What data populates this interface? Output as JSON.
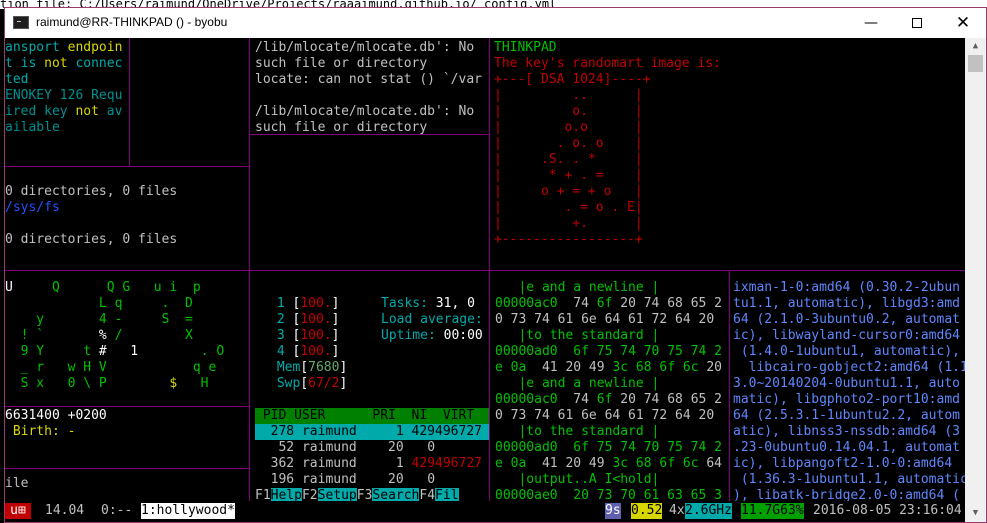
{
  "background": {
    "strip_text": "tion file: C:/Users/raimund/OneDrive/Projects/raaaimund.github.io/_config.yml"
  },
  "window": {
    "title": "raimund@RR-THINKPAD () - byobu",
    "icon": "console-icon",
    "minimize": "—",
    "close": "✕"
  },
  "pane_tl": {
    "lines": [
      {
        "segs": [
          {
            "t": "ansport ",
            "c": "c"
          },
          {
            "t": "endpoin",
            "c": "y"
          }
        ]
      },
      {
        "segs": [
          {
            "t": "t is ",
            "c": "c"
          },
          {
            "t": "not",
            "c": "y"
          },
          {
            "t": " connec",
            "c": "c"
          }
        ]
      },
      {
        "segs": [
          {
            "t": "ted",
            "c": "c"
          }
        ]
      },
      {
        "segs": [
          {
            "t": "ENOKEY 126 Requ",
            "c": "dg"
          }
        ]
      },
      {
        "segs": [
          {
            "t": "ired key ",
            "c": "dg"
          },
          {
            "t": "not",
            "c": "y"
          },
          {
            "t": " av",
            "c": "dg"
          }
        ]
      },
      {
        "segs": [
          {
            "t": "ailable",
            "c": "dg"
          }
        ]
      }
    ]
  },
  "pane_tm": {
    "lines": [
      "/lib/mlocate/mlocate.db': No",
      "such file or directory",
      "locate: can not stat () `/var",
      "",
      "/lib/mlocate/mlocate.db': No",
      "such file or directory"
    ]
  },
  "pane_ml": {
    "lines": [
      {
        "t": "0 directories, 0 files",
        "c": "w"
      },
      {
        "t": "/sys/fs",
        "c": "bl"
      },
      {
        "t": "",
        "c": "w"
      },
      {
        "t": "0 directories, 0 files",
        "c": "w"
      }
    ]
  },
  "randomart": {
    "host": "THINKPAD",
    "header": "The key's randomart image is:",
    "lines": [
      "+---[ DSA 1024]----+",
      "|         ..      |",
      "|         o.      |",
      "|        o.o      |",
      "|       . o. o    |",
      "|     .S. . *     |",
      "|      * + . =    |",
      "|     o + = + o   |",
      "|        . = o . E|",
      "|         +.      |",
      "+-----------------+"
    ]
  },
  "matrix": {
    "lines": [
      [
        {
          "t": "U",
          "c": "b"
        },
        {
          "t": "     Q      Q G   u i  p",
          "c": "g"
        }
      ],
      [
        {
          "t": "            L q     .  D",
          "c": "g"
        }
      ],
      [
        {
          "t": "    y       4 -     S  =",
          "c": "g"
        }
      ],
      [
        {
          "t": "  ! `       ",
          "c": "g"
        },
        {
          "t": "%",
          "c": "b"
        },
        {
          "t": " /        X",
          "c": "g"
        }
      ],
      [
        {
          "t": "  9 Y     t ",
          "c": "g"
        },
        {
          "t": "#",
          "c": "b"
        },
        {
          "t": "   ",
          "c": "g"
        },
        {
          "t": "1",
          "c": "b"
        },
        {
          "t": "        . O",
          "c": "g"
        }
      ],
      [
        {
          "t": "  _ r   w H V           q e",
          "c": "g"
        }
      ],
      [
        {
          "t": "  S x   0 \\ P        ",
          "c": "g"
        },
        {
          "t": "$",
          "c": "y"
        },
        {
          "t": "   H",
          "c": "g"
        }
      ]
    ]
  },
  "stat": {
    "lines": [
      [
        {
          "t": "6631400 +0200",
          "c": "b"
        }
      ],
      [
        {
          "t": " Birth: -",
          "c": "y"
        }
      ]
    ]
  },
  "bottom_left": {
    "text": "ile"
  },
  "htop": {
    "cpus": [
      {
        "n": "1",
        "v": "100."
      },
      {
        "n": "2",
        "v": "100."
      },
      {
        "n": "3",
        "v": "100."
      },
      {
        "n": "4",
        "v": "100."
      }
    ],
    "mem_label": "Mem",
    "mem_val": "7680",
    "swp_label": "Swp",
    "swp_val": "67/2",
    "tasks_label": "Tasks:",
    "tasks_val": "31, 0",
    "load_label": "Load average:",
    "uptime_label": "Uptime:",
    "uptime_val": "00:00",
    "headers": {
      "pid": "PID",
      "user": "USER",
      "pri": "PRI",
      "ni": "NI",
      "virt": "VIRT"
    },
    "rows": [
      {
        "pid": "278",
        "user": "raimund",
        "pri": "1",
        "ni": "429496727",
        "selected": true
      },
      {
        "pid": "52",
        "user": "raimund",
        "pri": "20",
        "ni": "0",
        "selected": false
      },
      {
        "pid": "362",
        "user": "raimund",
        "pri": "1",
        "ni": "429496727",
        "selected": false
      },
      {
        "pid": "196",
        "user": "raimund",
        "pri": "20",
        "ni": "0",
        "selected": false
      }
    ],
    "fkeys": [
      {
        "k": "F1",
        "l": "Help"
      },
      {
        "k": "F2",
        "l": "Setup"
      },
      {
        "k": "F3",
        "l": "Search"
      },
      {
        "k": "F4",
        "l": "Fil"
      }
    ]
  },
  "hexdump": {
    "lines": [
      [
        {
          "t": "   |e and a newline |",
          "c": "g"
        }
      ],
      [
        {
          "t": "00000ac0  ",
          "c": "g"
        },
        {
          "t": "74 ",
          "c": "w"
        },
        {
          "t": "6f ",
          "c": "g"
        },
        {
          "t": "20 74 68 65 2",
          "c": "w"
        }
      ],
      [
        {
          "t": "0 73 74 61 6e 64 61 72 64 20",
          "c": "w"
        }
      ],
      [
        {
          "t": "   |to the standard |",
          "c": "g"
        }
      ],
      [
        {
          "t": "00000ad0  ",
          "c": "g"
        },
        {
          "t": "6f 75 74 70 75 74 2",
          "c": "g"
        }
      ],
      [
        {
          "t": "e 0a  ",
          "c": "g"
        },
        {
          "t": "41 20 49 ",
          "c": "w"
        },
        {
          "t": "3c 68 6f 6c ",
          "c": "g"
        },
        {
          "t": "20",
          "c": "w"
        }
      ],
      [
        {
          "t": "   |e and a newline |",
          "c": "g"
        }
      ],
      [
        {
          "t": "00000ac0  ",
          "c": "g"
        },
        {
          "t": "74 ",
          "c": "w"
        },
        {
          "t": "6f ",
          "c": "g"
        },
        {
          "t": "20 74 68 65 2",
          "c": "w"
        }
      ],
      [
        {
          "t": "0 73 74 61 6e 64 61 72 64 20",
          "c": "w"
        }
      ],
      [
        {
          "t": "   |to the standard |",
          "c": "g"
        }
      ],
      [
        {
          "t": "00000ad0  ",
          "c": "g"
        },
        {
          "t": "6f 75 74 70 75 74 2",
          "c": "g"
        }
      ],
      [
        {
          "t": "e 0a  ",
          "c": "g"
        },
        {
          "t": "41 20 49 ",
          "c": "w"
        },
        {
          "t": "3c 68 6f 6c ",
          "c": "g"
        },
        {
          "t": "64",
          "c": "w"
        }
      ],
      [
        {
          "t": "   |output..A I<hold|",
          "c": "g"
        }
      ],
      [
        {
          "t": "00000ae0  20 73 70 61 63 65 3",
          "c": "g"
        }
      ]
    ]
  },
  "apt": {
    "lines": [
      "ixman-1-0:amd64 (0.30.2-2ubun",
      "tu1.1, automatic), libgd3:amd",
      "64 (2.1.0-3ubuntu0.2, automat",
      "ic), libwayland-cursor0:amd64",
      " (1.4.0-1ubuntu1, automatic),",
      "  libcairo-gobject2:amd64 (1.1",
      "3.0~20140204-0ubuntu1.1, auto",
      "matic), libgphoto2-port10:amd",
      "64 (2.5.3.1-1ubuntu2.2, autom",
      "atic), libnss3-nssdb:amd64 (3",
      ".23-0ubuntu0.14.04.1, automat",
      "ic), libpangoft2-1.0-0:amd64 ",
      " (1.36.3-1ubuntu1.1, automatic",
      "), libatk-bridge2.0-0:amd64 ("
    ]
  },
  "statusbar": {
    "logo": "u⊞",
    "release": "14.04",
    "window0": "0:--",
    "window1": "1:hollywood*",
    "updates": "9s",
    "load": "0.52",
    "cpu_count": "4x",
    "cpu_freq": "2.6GHz",
    "mem": "11.7G63%",
    "datetime": "2016-08-05 23:16:04"
  }
}
